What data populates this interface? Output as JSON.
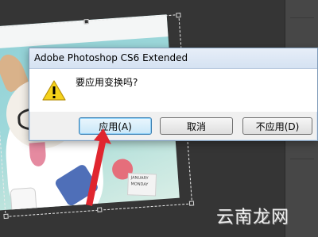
{
  "dialog": {
    "title": "Adobe Photoshop CS6 Extended",
    "message": "要应用变换吗?",
    "icon": "warning-icon",
    "buttons": {
      "apply": "应用(A)",
      "cancel": "取消",
      "dont_apply": "不应用(D)"
    }
  },
  "canvas": {
    "calendar_line1": "JANUARY",
    "calendar_line2": "MONDAY"
  },
  "watermark": {
    "text": "云南龙网"
  },
  "colors": {
    "arrow": "#e0262f",
    "dialog_border": "#7f9bb9",
    "workspace": "#353535"
  }
}
